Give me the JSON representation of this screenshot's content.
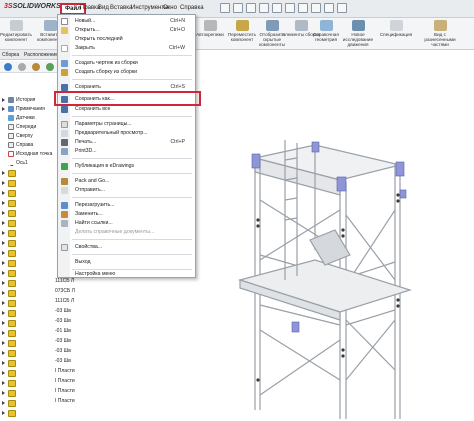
{
  "app": {
    "logo_prefix": "3S",
    "logo_text": "SOLIDWORKS"
  },
  "menubar": {
    "items": [
      "Файл",
      "Правка",
      "Вид",
      "Вставка",
      "Инструменты",
      "Окно",
      "Справка"
    ]
  },
  "ribbon": {
    "left_labels": [
      "Редактировать компонент",
      "Вставить компоненты"
    ],
    "buttons": [
      "Автокрепежи",
      "Переместить компонент",
      "Отобразить скрытые компоненты",
      "Элементы сборки",
      "Справочная геометрия",
      "Новое исследование движения",
      "Спецификация",
      "Вид с разнесенными частями"
    ]
  },
  "command_tabs": [
    "Сборка",
    "Расположение"
  ],
  "file_menu": {
    "items": [
      {
        "label": "Новый...",
        "shortcut": "Ctrl+N",
        "icon": "new-doc-icon"
      },
      {
        "label": "Открыть...",
        "shortcut": "Ctrl+O",
        "icon": "open-folder-icon"
      },
      {
        "label": "Открыть последний",
        "shortcut": "",
        "icon": ""
      },
      {
        "label": "Закрыть",
        "shortcut": "Ctrl+W",
        "icon": "close-doc-icon"
      },
      {
        "label": "Создать чертеж из сборки",
        "shortcut": "",
        "icon": "drawing-icon"
      },
      {
        "label": "Создать сборку из сборки",
        "shortcut": "",
        "icon": "assembly-icon"
      },
      {
        "label": "Сохранить",
        "shortcut": "Ctrl+S",
        "icon": "save-icon"
      },
      {
        "label": "Сохранить как...",
        "shortcut": "",
        "icon": "save-as-icon"
      },
      {
        "label": "Сохранить все",
        "shortcut": "",
        "icon": "save-all-icon"
      },
      {
        "label": "Параметры страницы...",
        "shortcut": "",
        "icon": "page-setup-icon"
      },
      {
        "label": "Предварительный просмотр...",
        "shortcut": "",
        "icon": "preview-icon"
      },
      {
        "label": "Печать...",
        "shortcut": "Ctrl+P",
        "icon": "print-icon"
      },
      {
        "label": "Print3D...",
        "shortcut": "",
        "icon": "print3d-icon"
      },
      {
        "label": "Публикация в eDrawings",
        "shortcut": "",
        "icon": "edrawings-icon"
      },
      {
        "label": "Pack and Go...",
        "shortcut": "",
        "icon": "pack-go-icon"
      },
      {
        "label": "Отправить...",
        "shortcut": "",
        "icon": "send-icon"
      },
      {
        "label": "Перезагрузить...",
        "shortcut": "",
        "icon": "reload-icon"
      },
      {
        "label": "Заменить...",
        "shortcut": "",
        "icon": "replace-icon"
      },
      {
        "label": "Найти ссылки...",
        "shortcut": "",
        "icon": "find-refs-icon"
      },
      {
        "label": "Делать справочные документы...",
        "shortcut": "",
        "icon": ""
      },
      {
        "label": "Свойства...",
        "shortcut": "",
        "icon": "properties-icon"
      },
      {
        "label": "Выход",
        "shortcut": "",
        "icon": ""
      },
      {
        "label": "Настройка меню",
        "shortcut": "",
        "icon": ""
      }
    ]
  },
  "tree": {
    "items": [
      {
        "label": "История",
        "icon": "history-icon"
      },
      {
        "label": "Примечания",
        "icon": "notes-icon"
      },
      {
        "label": "Датчики",
        "icon": "sensor-icon"
      },
      {
        "label": "Спереди",
        "icon": "plane-icon"
      },
      {
        "label": "Сверху",
        "icon": "plane-icon"
      },
      {
        "label": "Справа",
        "icon": "plane-icon"
      },
      {
        "label": "Исходная точка",
        "icon": "origin-icon"
      },
      {
        "label": "Ось1",
        "icon": "axis-icon"
      }
    ],
    "part_labels": [
      "111СБ Л",
      "073СБ Л",
      "111СБ Л",
      "-03 Шв",
      "-03 Шв",
      "-01 Шв",
      "-03 Шв",
      "-03 Шв",
      "-03 Шв",
      "I Пласти",
      "I Пласти",
      "I Пласти",
      "I Пласти"
    ]
  }
}
